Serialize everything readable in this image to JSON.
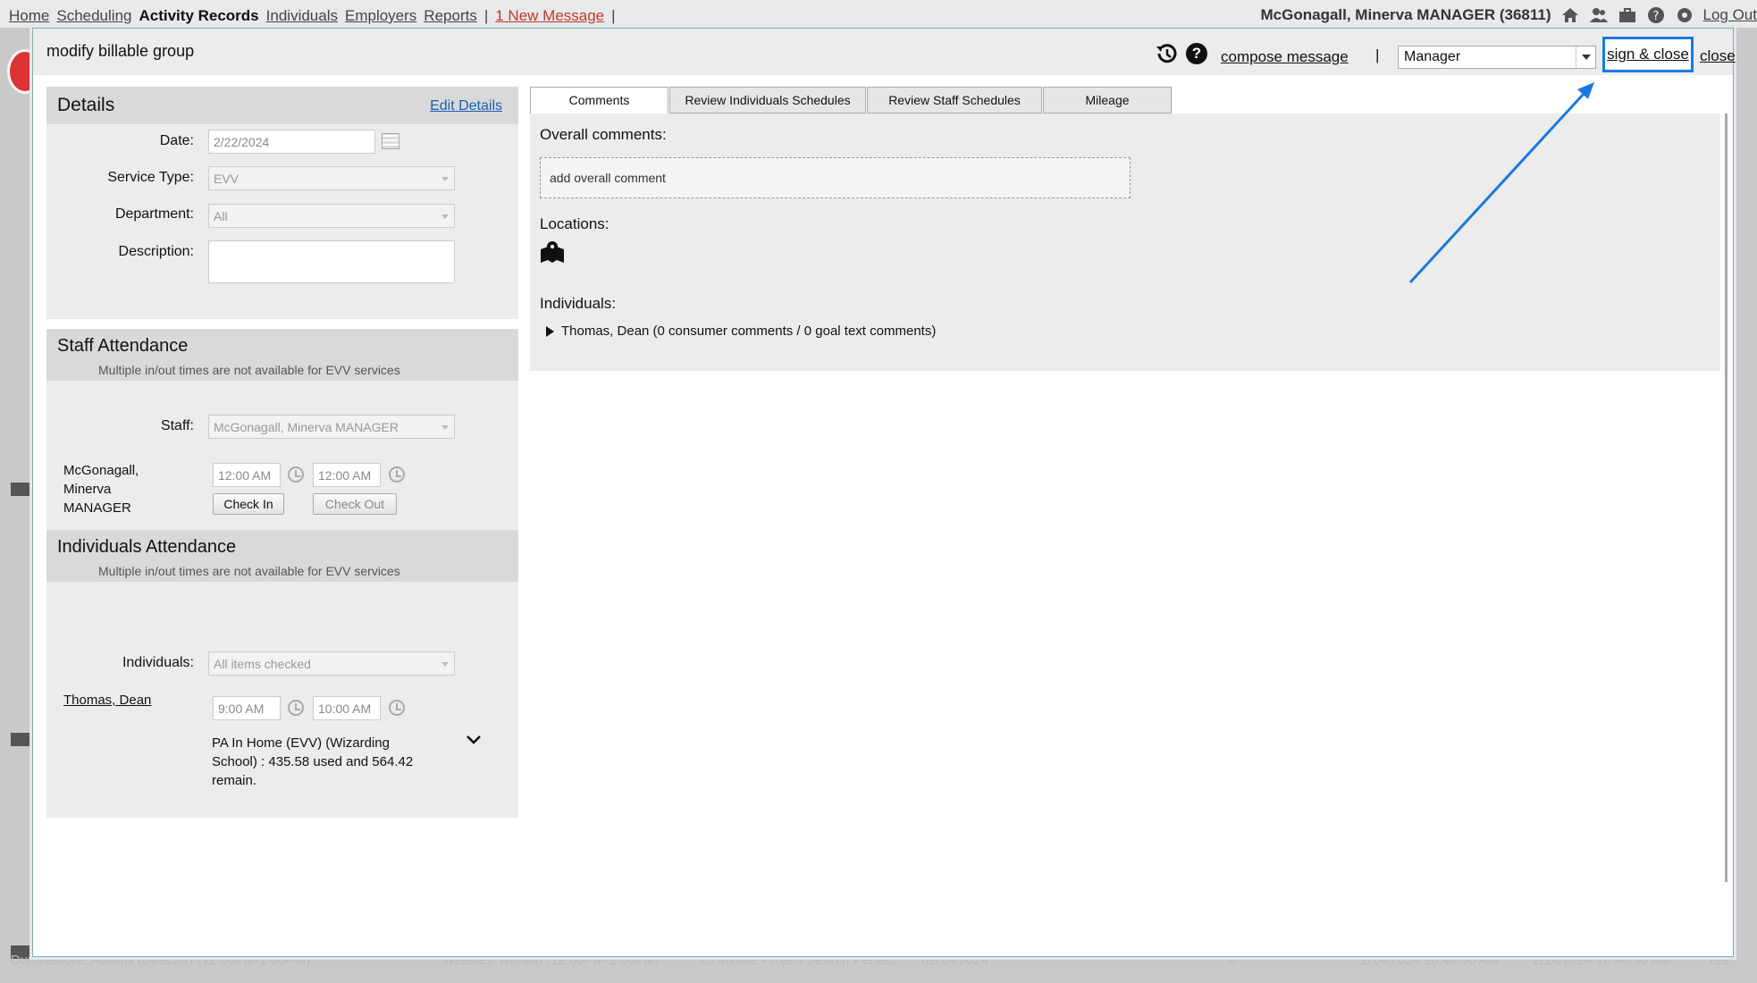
{
  "topbar": {
    "nav": [
      "Home",
      "Scheduling",
      "Activity Records",
      "Individuals",
      "Employers",
      "Reports"
    ],
    "active": "Activity Records",
    "separator": "|",
    "new_message": "1 New Message",
    "user": "McGonagall, Minerva MANAGER (36811)",
    "logout": "Log Out"
  },
  "modal": {
    "title": "modify billable group",
    "compose_message": "compose message",
    "pipe": "|",
    "role_value": "Manager",
    "sign_close": "sign & close",
    "close": "close"
  },
  "details": {
    "heading": "Details",
    "edit_link": "Edit Details",
    "date_label": "Date:",
    "date_value": "2/22/2024",
    "service_type_label": "Service Type:",
    "service_type_value": "EVV",
    "department_label": "Department:",
    "department_value": "All",
    "description_label": "Description:",
    "description_value": ""
  },
  "staff_attendance": {
    "heading": "Staff Attendance",
    "note": "Multiple in/out times are not available for EVV services",
    "staff_label": "Staff:",
    "staff_value": "McGonagall, Minerva MANAGER",
    "row_name_1": "McGonagall,",
    "row_name_2": "Minerva",
    "row_name_3": "MANAGER",
    "time_in": "12:00 AM",
    "time_out": "12:00 AM",
    "check_in": "Check In",
    "check_out": "Check Out"
  },
  "individuals_attendance": {
    "heading": "Individuals Attendance",
    "note": "Multiple in/out times are not available for EVV services",
    "individuals_label": "Individuals:",
    "individuals_value": "All items checked",
    "person": "Thomas, Dean",
    "time_in": "9:00 AM",
    "time_out": "10:00 AM",
    "auth_line_1": "PA In Home (EVV) (Wizarding",
    "auth_line_2": "School) : 435.58 used and 564.42",
    "auth_line_3": "remain."
  },
  "tabs": [
    "Comments",
    "Review Individuals Schedules",
    "Review Staff Schedules",
    "Mileage"
  ],
  "comments": {
    "overall_label": "Overall comments:",
    "overall_placeholder": "add overall comment",
    "locations_label": "Locations:",
    "individuals_label": "Individuals:",
    "individual_row": "Thomas, Dean (0 consumer comments / 0  goal text comments)"
  },
  "background": {
    "footer_row": [
      "Dumbledore, ADMIN (Director) (12:00PM-1:00PM)",
      "Weasley, Ronald (12:00PM-1:00PM)",
      "15 Minute Project Search Perfect",
      "02/14/2024",
      "0",
      "2/14/2024 10:46:30 AM",
      "2/14/2024 10:46:30 AM",
      "Yes"
    ]
  },
  "colors": {
    "highlight": "#1a7ae0",
    "link": "#1a5fb4",
    "new_message": "#c0392b"
  }
}
